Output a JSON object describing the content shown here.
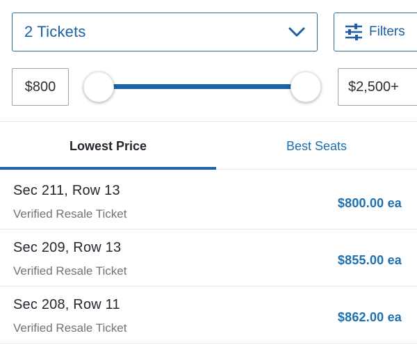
{
  "controls": {
    "quantity_value": "2 Tickets",
    "filters_label": "Filters",
    "price_min": "$800",
    "price_max": "$2,500+"
  },
  "tabs": [
    {
      "label": "Lowest Price",
      "active": true
    },
    {
      "label": "Best Seats",
      "active": false
    }
  ],
  "listings": [
    {
      "section": "Sec 211, Row 13",
      "type": "Verified Resale Ticket",
      "price": "$800.00 ea"
    },
    {
      "section": "Sec 209, Row 13",
      "type": "Verified Resale Ticket",
      "price": "$855.00 ea"
    },
    {
      "section": "Sec 208, Row 11",
      "type": "Verified Resale Ticket",
      "price": "$862.00 ea"
    }
  ],
  "colors": {
    "accent": "#1b6fb0",
    "slider": "#1d63a8",
    "border": "#2c6b9a"
  },
  "icons": {
    "dropdown": "chevron-down-icon",
    "filters": "sliders-icon"
  }
}
